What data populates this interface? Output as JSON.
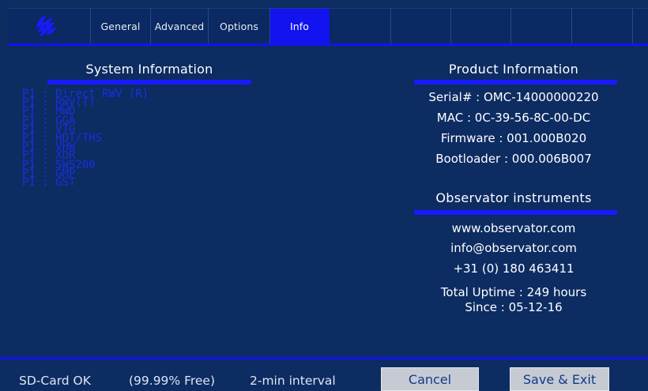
{
  "tabs": [
    {
      "label": "General",
      "active": false
    },
    {
      "label": "Advanced",
      "active": false
    },
    {
      "label": "Options",
      "active": false
    },
    {
      "label": "Info",
      "active": true
    }
  ],
  "logo_icon": "observator-logo",
  "system_info": {
    "title": "System Information",
    "items": [
      "P1 : Direct RWV (R)",
      "P1 : RWV(T)",
      "P1 : MWD",
      "P1 : GGA",
      "P1 : VTG",
      "P1 : HDT/THS",
      "P1 : VHW",
      "P1 : XDR",
      "P1 : SWS200",
      "P1 : GMP",
      "P1 : GST"
    ]
  },
  "product_info": {
    "title": "Product Information",
    "serial": "Serial# : OMC-14000000220",
    "mac": "MAC : 0C-39-56-8C-00-DC",
    "firmware": "Firmware : 001.000B020",
    "bootloader": "Bootloader : 000.006B007"
  },
  "company": {
    "title": "Observator instruments",
    "website": "www.observator.com",
    "email": "info@observator.com",
    "phone": "+31 (0) 180 463411",
    "uptime": "Total Uptime : 249 hours",
    "since": "Since : 05-12-16"
  },
  "footer": {
    "sd_status": "SD-Card OK",
    "free": "(99.99% Free)",
    "interval": "2-min interval",
    "cancel_label": "Cancel",
    "save_label": "Save & Exit"
  },
  "colors": {
    "background": "#0c2c62",
    "accent": "#1313f0",
    "dim_list_text": "#1b2fe0",
    "button_bg": "#c6cad3"
  }
}
